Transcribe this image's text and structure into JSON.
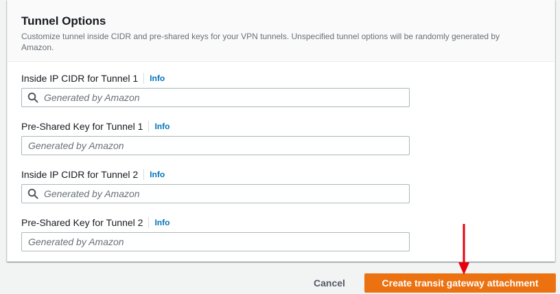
{
  "section": {
    "title": "Tunnel Options",
    "description": "Customize tunnel inside CIDR and pre-shared keys for your VPN tunnels. Unspecified tunnel options will be randomly generated by Amazon."
  },
  "fields": [
    {
      "label": "Inside IP CIDR for Tunnel 1",
      "info": "Info",
      "placeholder": "Generated by Amazon",
      "value": "",
      "icon": "search-icon"
    },
    {
      "label": "Pre-Shared Key for Tunnel 1",
      "info": "Info",
      "placeholder": "Generated by Amazon",
      "value": ""
    },
    {
      "label": "Inside IP CIDR for Tunnel 2",
      "info": "Info",
      "placeholder": "Generated by Amazon",
      "value": "",
      "icon": "search-icon"
    },
    {
      "label": "Pre-Shared Key for Tunnel 2",
      "info": "Info",
      "placeholder": "Generated by Amazon",
      "value": ""
    }
  ],
  "actions": {
    "cancel_label": "Cancel",
    "create_label": "Create transit gateway attachment"
  },
  "colors": {
    "primary_button": "#ec7211",
    "link": "#0073bb",
    "annotation_arrow": "#e8000b"
  }
}
